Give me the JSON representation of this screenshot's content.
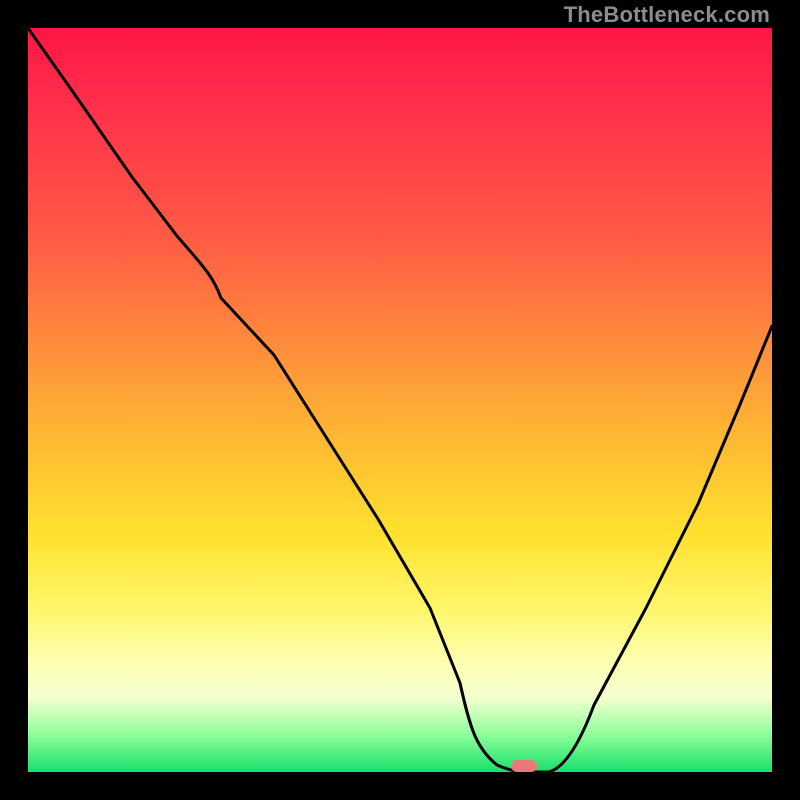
{
  "watermark": "TheBottleneck.com",
  "chart_data": {
    "type": "line",
    "title": "",
    "xlabel": "",
    "ylabel": "",
    "xlim": [
      0,
      1
    ],
    "ylim": [
      0,
      1
    ],
    "background": {
      "type": "gradient-vertical",
      "stops": [
        {
          "pos": 0.0,
          "color": "#ff1546"
        },
        {
          "pos": 0.1,
          "color": "#ff2f4b"
        },
        {
          "pos": 0.28,
          "color": "#ff5a45"
        },
        {
          "pos": 0.42,
          "color": "#ff8a3c"
        },
        {
          "pos": 0.55,
          "color": "#ffb833"
        },
        {
          "pos": 0.68,
          "color": "#ffe12e"
        },
        {
          "pos": 0.78,
          "color": "#fff66a"
        },
        {
          "pos": 0.85,
          "color": "#feffb0"
        },
        {
          "pos": 0.9,
          "color": "#f4ffd0"
        },
        {
          "pos": 0.95,
          "color": "#8eff9a"
        },
        {
          "pos": 1.0,
          "color": "#17e06b"
        }
      ]
    },
    "series": [
      {
        "name": "bottleneck-curve",
        "x": [
          0.0,
          0.07,
          0.14,
          0.2,
          0.26,
          0.33,
          0.4,
          0.47,
          0.54,
          0.58,
          0.6,
          0.63,
          0.67,
          0.7,
          0.76,
          0.83,
          0.9,
          0.955,
          1.0
        ],
        "y": [
          1.0,
          0.9,
          0.8,
          0.72,
          0.67,
          0.56,
          0.45,
          0.34,
          0.22,
          0.12,
          0.05,
          0.01,
          0.0,
          0.0,
          0.09,
          0.22,
          0.36,
          0.49,
          0.6
        ]
      }
    ],
    "marker": {
      "x": 0.665,
      "y": 0.005,
      "color": "#e77a78",
      "shape": "pill"
    }
  }
}
